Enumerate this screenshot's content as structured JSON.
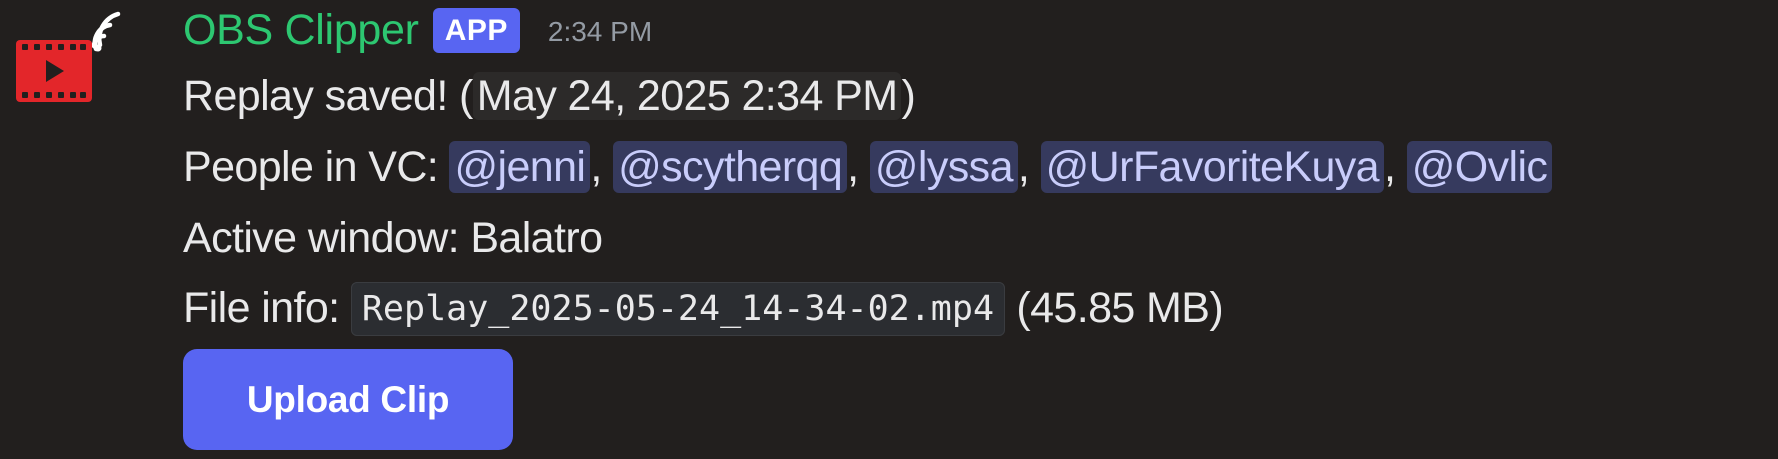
{
  "message": {
    "author": "OBS Clipper",
    "badge": "APP",
    "timestamp": "2:34 PM",
    "avatar_icon": "obs-clipper-video-camera-icon",
    "colors": {
      "author": "#2dc771",
      "badge_bg": "#5865f2",
      "avatar_red": "#e3262a",
      "mention_bg": "#363a5e",
      "mention_text": "#c9cdfb",
      "button_bg": "#5865f2",
      "background": "#221f1e"
    },
    "line1": {
      "text": "Replay saved!",
      "open_paren": "(",
      "datetime": "May 24, 2025 2:34 PM",
      "close_paren": ")"
    },
    "line2": {
      "label": "People in VC: ",
      "mentions": [
        "@jenni",
        "@scytherqq",
        "@lyssa",
        "@UrFavoriteKuya",
        "@Ovlic"
      ],
      "separator": ", "
    },
    "line3": {
      "text": "Active window: Balatro"
    },
    "line4": {
      "label": "File info: ",
      "filename": "Replay_2025-05-24_14-34-02.mp4",
      "size": "(45.85 MB)"
    },
    "button": {
      "label": "Upload Clip"
    }
  }
}
